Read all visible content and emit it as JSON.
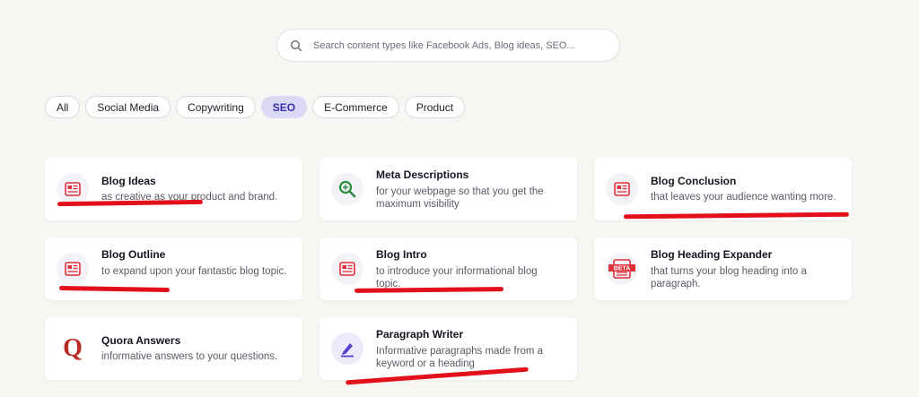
{
  "search": {
    "placeholder": "Search content types like Facebook Ads, Blog ideas, SEO..."
  },
  "tabs": [
    {
      "label": "All",
      "active": false
    },
    {
      "label": "Social Media",
      "active": false
    },
    {
      "label": "Copywriting",
      "active": false
    },
    {
      "label": "SEO",
      "active": true
    },
    {
      "label": "E-Commerce",
      "active": false
    },
    {
      "label": "Product",
      "active": false
    }
  ],
  "cards": [
    {
      "title": "Blog Ideas",
      "description": "as creative as your product and brand.",
      "icon": "blog-document-icon"
    },
    {
      "title": "Meta Descriptions",
      "description": "for your webpage so that you get the maximum visibility",
      "icon": "magnifier-search-icon"
    },
    {
      "title": "Blog Conclusion",
      "description": "that leaves your audience wanting more.",
      "icon": "blog-document-icon"
    },
    {
      "title": "Blog Outline",
      "description": "to expand upon your fantastic blog topic.",
      "icon": "blog-document-icon"
    },
    {
      "title": "Blog Intro",
      "description": "to introduce your informational blog topic.",
      "icon": "blog-document-icon"
    },
    {
      "title": "Blog Heading Expander",
      "description": "that turns your blog heading into a paragraph.",
      "icon": "beta-document-icon",
      "badge_text": "BETA"
    },
    {
      "title": "Quora Answers",
      "description": "informative answers to your questions.",
      "icon": "quora-logo-icon",
      "logo_text": "Q"
    },
    {
      "title": "Paragraph Writer",
      "description": "Informative paragraphs made from a keyword or a heading",
      "icon": "pen-writing-icon"
    }
  ],
  "colors": {
    "background": "#f8f6f3",
    "accent": "#3a2fb0",
    "active_tab_bg": "#dcd9f7",
    "icon_red": "#e0303a",
    "icon_green": "#2e8b3e",
    "icon_purple": "#5b3fd0",
    "quora_red": "#b92b27",
    "annotation_red": "#e3101b"
  }
}
